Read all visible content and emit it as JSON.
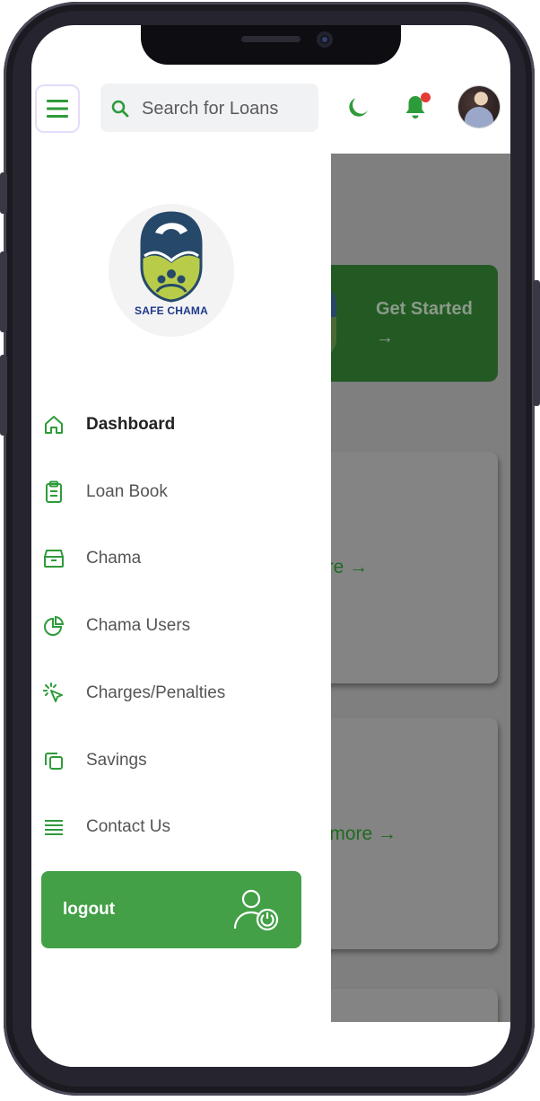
{
  "search": {
    "placeholder": "Search for Loans"
  },
  "header": {
    "icons": [
      "menu-icon",
      "search-icon",
      "moon-icon",
      "bell-icon",
      "avatar"
    ],
    "notification_dot": true
  },
  "brand": {
    "logo_text": "SAFE CHAMA"
  },
  "sidebar": {
    "items": [
      {
        "label": "Dashboard",
        "icon": "home-icon",
        "active": true
      },
      {
        "label": "Loan Book",
        "icon": "clipboard-icon",
        "active": false
      },
      {
        "label": "Chama",
        "icon": "archive-icon",
        "active": false
      },
      {
        "label": "Chama Users",
        "icon": "pie-chart-icon",
        "active": false
      },
      {
        "label": "Charges/Penalties",
        "icon": "cursor-click-icon",
        "active": false
      },
      {
        "label": "Savings",
        "icon": "copy-icon",
        "active": false
      },
      {
        "label": "Contact Us",
        "icon": "list-icon",
        "active": false
      }
    ],
    "logout_label": "logout"
  },
  "background": {
    "get_started": "Get Started",
    "get_started_arrow": "→",
    "more_1": "ore →",
    "more_2": "v more →"
  },
  "colors": {
    "accent": "#43a047",
    "icon_green": "#2e9b3a",
    "active_text": "#222222",
    "notification": "#e53935"
  }
}
